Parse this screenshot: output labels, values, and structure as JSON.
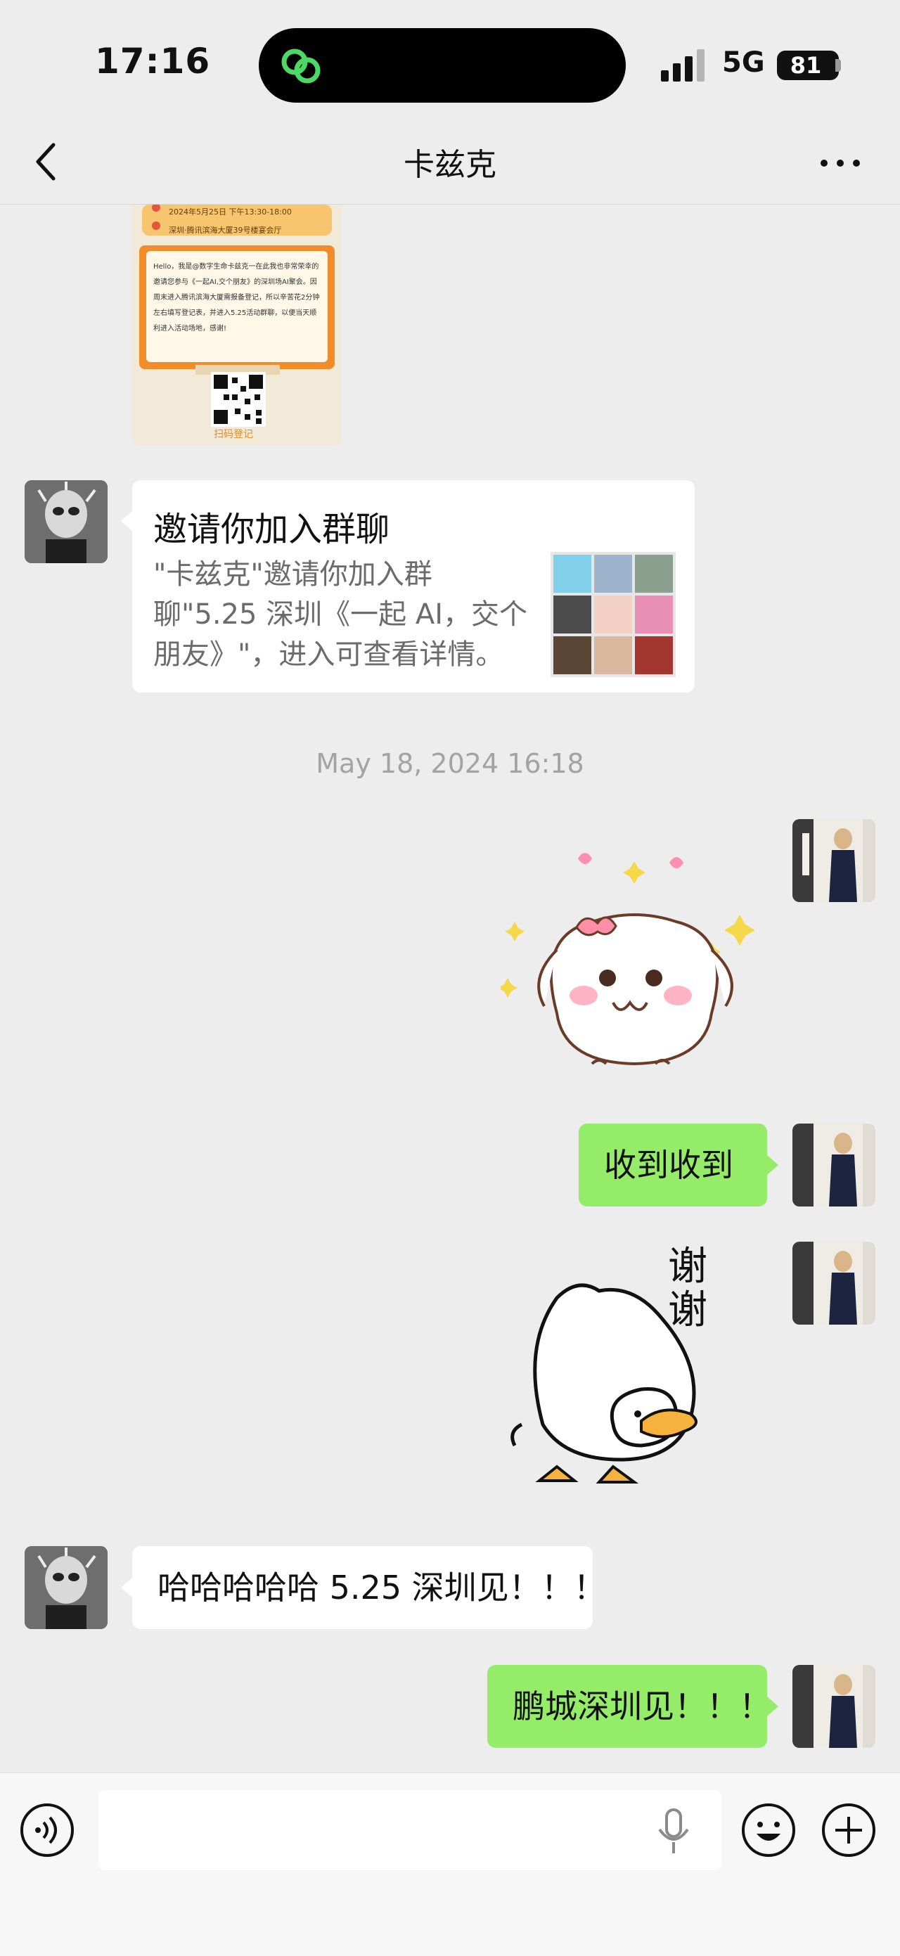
{
  "status_bar": {
    "time": "17:16",
    "network": "5G",
    "battery": "81"
  },
  "header": {
    "title": "卡兹克"
  },
  "messages": {
    "poster": {
      "date_line": "2024年5月25日 下午13:30-18:00",
      "location_line": "深圳·腾讯滨海大厦39号楼宴会厅",
      "body": "Hello，我是@数字生命卡兹克一在此我也非常荣幸的邀请您参与《一起AI,交个朋友》的深圳场AI聚会。因周末进入腾讯滨海大厦需报备登记，所以辛苦花2分钟左右填写登记表，并进入5.25活动群聊，以便当天顺利进入活动场地，感谢!",
      "qr_caption": "扫码登记"
    },
    "invite_card": {
      "title": "邀请你加入群聊",
      "description": "\"卡兹克\"邀请你加入群聊\"5.25 深圳《一起 AI，交个朋友》\"，进入可查看详情。"
    },
    "timestamp": "May 18, 2024 16:18",
    "reply_1": "收到收到",
    "sticker_thanks_text": "谢谢",
    "karzak_reply": "哈哈哈哈哈 5.25 深圳见！！！",
    "reply_2": "鹏城深圳见！！！"
  },
  "input_bar": {
    "placeholder": ""
  },
  "colors": {
    "background": "#ededed",
    "my_bubble": "#95ec69",
    "their_bubble": "#ffffff",
    "timestamp": "#a3a3a3"
  }
}
